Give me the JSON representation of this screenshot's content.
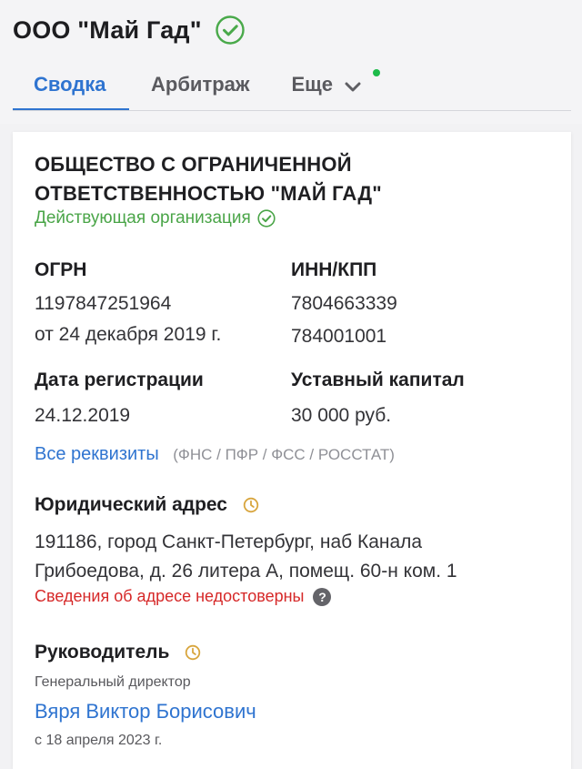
{
  "header": {
    "company_title": "ООО \"Май Гад\"",
    "tabs": [
      {
        "label": "Сводка",
        "active": true
      },
      {
        "label": "Арбитраж",
        "active": false
      },
      {
        "label": "Еще",
        "active": false,
        "has_dropdown": true,
        "notification_dot": true
      }
    ]
  },
  "card": {
    "legal_name": "ОБЩЕСТВО С ОГРАНИЧЕННОЙ ОТВЕТСТВЕННОСТЬЮ \"МАЙ ГАД\"",
    "status": "Действующая организация",
    "ogrn": {
      "title": "ОГРН",
      "value": "1197847251964",
      "date": "от 24 декабря 2019 г."
    },
    "inn_kpp": {
      "title": "ИНН/КПП",
      "inn": "7804663339",
      "kpp": "784001001"
    },
    "registration": {
      "title": "Дата регистрации",
      "value": "24.12.2019"
    },
    "capital": {
      "title": "Уставный капитал",
      "value": "30 000 руб."
    },
    "requisites": {
      "link": "Все реквизиты",
      "sources": "(ФНС / ПФР / ФСС / РОССТАТ)"
    },
    "address": {
      "title": "Юридический адрес",
      "line1": "191186, город Санкт-Петербург, наб Канала",
      "line2": "Грибоедова, д. 26 литера А, помещ. 60-н ком. 1",
      "warning": "Сведения об адресе недостоверны",
      "help_icon": "?"
    },
    "director": {
      "title": "Руководитель",
      "position": "Генеральный директор",
      "name": "Вяря Виктор Борисович",
      "since": "с 18 апреля 2023 г."
    }
  },
  "colors": {
    "accent_blue": "#2f74d0",
    "active_green": "#4aa548",
    "warning_red": "#d62828",
    "clock_orange": "#d8a53d",
    "notification_green": "#1dbb4a"
  },
  "icons": {
    "verified": "check-circle-icon",
    "chevron": "chevron-down-icon",
    "clock": "clock-icon",
    "help": "question-circle-icon"
  }
}
